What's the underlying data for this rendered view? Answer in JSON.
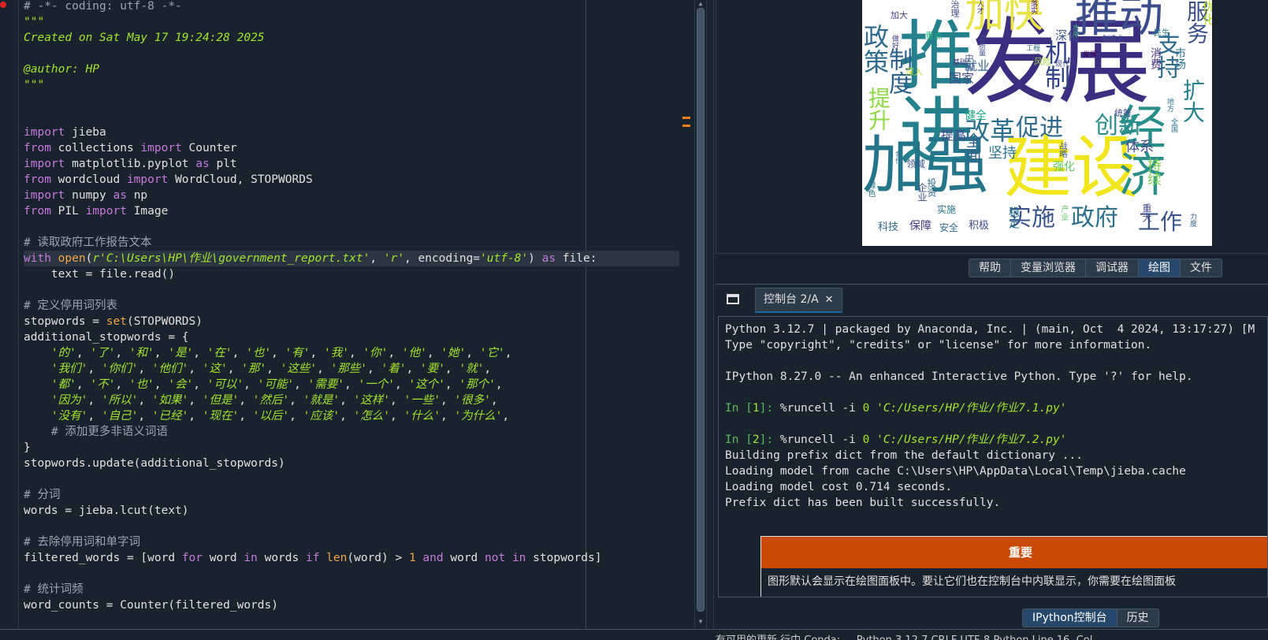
{
  "editor": {
    "lines": [
      [
        [
          "cm",
          "# -*- coding: utf-8 -*-"
        ]
      ],
      [
        [
          "doc",
          "\"\"\""
        ]
      ],
      [
        [
          "doc",
          "Created on Sat May 17 19:24:28 2025"
        ]
      ],
      [
        [
          "doc",
          ""
        ]
      ],
      [
        [
          "doc",
          "@author: HP"
        ]
      ],
      [
        [
          "doc",
          "\"\"\""
        ]
      ],
      [
        [
          "",
          ""
        ]
      ],
      [
        [
          "",
          ""
        ]
      ],
      [
        [
          "kw",
          "import"
        ],
        [
          "",
          " jieba"
        ]
      ],
      [
        [
          "kw",
          "from"
        ],
        [
          "",
          " collections "
        ],
        [
          "kw",
          "import"
        ],
        [
          "",
          " Counter"
        ]
      ],
      [
        [
          "kw",
          "import"
        ],
        [
          "",
          " matplotlib.pyplot "
        ],
        [
          "kw",
          "as"
        ],
        [
          "",
          " plt"
        ]
      ],
      [
        [
          "kw",
          "from"
        ],
        [
          "",
          " wordcloud "
        ],
        [
          "kw",
          "import"
        ],
        [
          "",
          " WordCloud, STOPWORDS"
        ]
      ],
      [
        [
          "kw",
          "import"
        ],
        [
          "",
          " numpy "
        ],
        [
          "kw",
          "as"
        ],
        [
          "",
          " np"
        ]
      ],
      [
        [
          "kw",
          "from"
        ],
        [
          "",
          " PIL "
        ],
        [
          "kw",
          "import"
        ],
        [
          "",
          " Image"
        ]
      ],
      [
        [
          "",
          ""
        ]
      ],
      [
        [
          "cm",
          "# 读取政府工作报告文本"
        ]
      ],
      [
        [
          "kw",
          "with"
        ],
        [
          "",
          " "
        ],
        [
          "bi",
          "open"
        ],
        [
          "",
          "("
        ],
        [
          "st",
          "r'C:\\Users\\HP\\作业\\government_report.txt'"
        ],
        [
          "",
          ", "
        ],
        [
          "st",
          "'r'"
        ],
        [
          "",
          ", encoding="
        ],
        [
          "st",
          "'utf-8'"
        ],
        [
          "",
          ") "
        ],
        [
          "kw",
          "as"
        ],
        [
          "",
          " file:"
        ]
      ],
      [
        [
          "",
          "    text = file.read()"
        ]
      ],
      [
        [
          "",
          ""
        ]
      ],
      [
        [
          "cm",
          "# 定义停用词列表"
        ]
      ],
      [
        [
          "",
          "stopwords = "
        ],
        [
          "bi",
          "set"
        ],
        [
          "",
          "(STOPWORDS)"
        ]
      ],
      [
        [
          "",
          "additional_stopwords = {"
        ]
      ],
      [
        [
          "",
          "    "
        ],
        [
          "st",
          "'的'"
        ],
        [
          "",
          ", "
        ],
        [
          "st",
          "'了'"
        ],
        [
          "",
          ", "
        ],
        [
          "st",
          "'和'"
        ],
        [
          "",
          ", "
        ],
        [
          "st",
          "'是'"
        ],
        [
          "",
          ", "
        ],
        [
          "st",
          "'在'"
        ],
        [
          "",
          ", "
        ],
        [
          "st",
          "'也'"
        ],
        [
          "",
          ", "
        ],
        [
          "st",
          "'有'"
        ],
        [
          "",
          ", "
        ],
        [
          "st",
          "'我'"
        ],
        [
          "",
          ", "
        ],
        [
          "st",
          "'你'"
        ],
        [
          "",
          ", "
        ],
        [
          "st",
          "'他'"
        ],
        [
          "",
          ", "
        ],
        [
          "st",
          "'她'"
        ],
        [
          "",
          ", "
        ],
        [
          "st",
          "'它'"
        ],
        [
          "",
          ","
        ]
      ],
      [
        [
          "",
          "    "
        ],
        [
          "st",
          "'我们'"
        ],
        [
          "",
          ", "
        ],
        [
          "st",
          "'你们'"
        ],
        [
          "",
          ", "
        ],
        [
          "st",
          "'他们'"
        ],
        [
          "",
          ", "
        ],
        [
          "st",
          "'这'"
        ],
        [
          "",
          ", "
        ],
        [
          "st",
          "'那'"
        ],
        [
          "",
          ", "
        ],
        [
          "st",
          "'这些'"
        ],
        [
          "",
          ", "
        ],
        [
          "st",
          "'那些'"
        ],
        [
          "",
          ", "
        ],
        [
          "st",
          "'着'"
        ],
        [
          "",
          ", "
        ],
        [
          "st",
          "'要'"
        ],
        [
          "",
          ", "
        ],
        [
          "st",
          "'就'"
        ],
        [
          "",
          ","
        ]
      ],
      [
        [
          "",
          "    "
        ],
        [
          "st",
          "'都'"
        ],
        [
          "",
          ", "
        ],
        [
          "st",
          "'不'"
        ],
        [
          "",
          ", "
        ],
        [
          "st",
          "'也'"
        ],
        [
          "",
          ", "
        ],
        [
          "st",
          "'会'"
        ],
        [
          "",
          ", "
        ],
        [
          "st",
          "'可以'"
        ],
        [
          "",
          ", "
        ],
        [
          "st",
          "'可能'"
        ],
        [
          "",
          ", "
        ],
        [
          "st",
          "'需要'"
        ],
        [
          "",
          ", "
        ],
        [
          "st",
          "'一个'"
        ],
        [
          "",
          ", "
        ],
        [
          "st",
          "'这个'"
        ],
        [
          "",
          ", "
        ],
        [
          "st",
          "'那个'"
        ],
        [
          "",
          ","
        ]
      ],
      [
        [
          "",
          "    "
        ],
        [
          "st",
          "'因为'"
        ],
        [
          "",
          ", "
        ],
        [
          "st",
          "'所以'"
        ],
        [
          "",
          ", "
        ],
        [
          "st",
          "'如果'"
        ],
        [
          "",
          ", "
        ],
        [
          "st",
          "'但是'"
        ],
        [
          "",
          ", "
        ],
        [
          "st",
          "'然后'"
        ],
        [
          "",
          ", "
        ],
        [
          "st",
          "'就是'"
        ],
        [
          "",
          ", "
        ],
        [
          "st",
          "'这样'"
        ],
        [
          "",
          ", "
        ],
        [
          "st",
          "'一些'"
        ],
        [
          "",
          ", "
        ],
        [
          "st",
          "'很多'"
        ],
        [
          "",
          ","
        ]
      ],
      [
        [
          "",
          "    "
        ],
        [
          "st",
          "'没有'"
        ],
        [
          "",
          ", "
        ],
        [
          "st",
          "'自己'"
        ],
        [
          "",
          ", "
        ],
        [
          "st",
          "'已经'"
        ],
        [
          "",
          ", "
        ],
        [
          "st",
          "'现在'"
        ],
        [
          "",
          ", "
        ],
        [
          "st",
          "'以后'"
        ],
        [
          "",
          ", "
        ],
        [
          "st",
          "'应该'"
        ],
        [
          "",
          ", "
        ],
        [
          "st",
          "'怎么'"
        ],
        [
          "",
          ", "
        ],
        [
          "st",
          "'什么'"
        ],
        [
          "",
          ", "
        ],
        [
          "st",
          "'为什么'"
        ],
        [
          "",
          ","
        ]
      ],
      [
        [
          "",
          "    "
        ],
        [
          "cm",
          "# 添加更多非语义词语"
        ]
      ],
      [
        [
          "",
          "}"
        ]
      ],
      [
        [
          "",
          "stopwords.update(additional_stopwords)"
        ]
      ],
      [
        [
          "",
          ""
        ]
      ],
      [
        [
          "cm",
          "# 分词"
        ]
      ],
      [
        [
          "",
          "words = jieba.lcut(text)"
        ]
      ],
      [
        [
          "",
          ""
        ]
      ],
      [
        [
          "cm",
          "# 去除停用词和单字词"
        ]
      ],
      [
        [
          "",
          "filtered_words = [word "
        ],
        [
          "kw",
          "for"
        ],
        [
          "",
          " word "
        ],
        [
          "kw",
          "in"
        ],
        [
          "",
          " words "
        ],
        [
          "kw",
          "if"
        ],
        [
          "",
          " "
        ],
        [
          "bi",
          "len"
        ],
        [
          "",
          "(word) > "
        ],
        [
          "nm",
          "1"
        ],
        [
          "",
          " "
        ],
        [
          "kw",
          "and"
        ],
        [
          "",
          " word "
        ],
        [
          "kw",
          "not"
        ],
        [
          "",
          " "
        ],
        [
          "kw",
          "in"
        ],
        [
          "",
          " stopwords]"
        ]
      ],
      [
        [
          "",
          ""
        ]
      ],
      [
        [
          "cm",
          "# 统计词频"
        ]
      ],
      [
        [
          "",
          "word_counts = Counter(filtered_words)"
        ]
      ]
    ],
    "highlighted_line": 16
  },
  "wordcloud": {
    "words": [
      {
        "t": "发展",
        "s": 118,
        "c": "#3b2d80"
      },
      {
        "t": "推进",
        "s": 96,
        "c": "#23808c"
      },
      {
        "t": "加强",
        "s": 80,
        "c": "#24748a"
      },
      {
        "t": "建设",
        "s": 86,
        "c": "#f1e51d"
      },
      {
        "t": "经济",
        "s": 60,
        "c": "#2a8f8a"
      },
      {
        "t": "推动",
        "s": 56,
        "c": "#3c4d8c"
      },
      {
        "t": "加快",
        "s": 50,
        "c": "#e9e34a"
      },
      {
        "t": "政策",
        "s": 32,
        "c": "#2f6c8e"
      },
      {
        "t": "制度",
        "s": 30,
        "c": "#2d5f8e"
      },
      {
        "t": "机制",
        "s": 32,
        "c": "#31418b"
      },
      {
        "t": "改革",
        "s": 32,
        "c": "#2b6f8e"
      },
      {
        "t": "促进",
        "s": 30,
        "c": "#2f6a8e"
      },
      {
        "t": "创新",
        "s": 30,
        "c": "#2a8e8b"
      },
      {
        "t": "提升",
        "s": 28,
        "c": "#8fd744"
      },
      {
        "t": "实施",
        "s": 30,
        "c": "#3a538b"
      },
      {
        "t": "政府",
        "s": 30,
        "c": "#2d708e"
      },
      {
        "t": "工作",
        "s": 28,
        "c": "#3b528b"
      },
      {
        "t": "支持",
        "s": 30,
        "c": "#2f6b8e"
      },
      {
        "t": "扩大",
        "s": 28,
        "c": "#26828e"
      },
      {
        "t": "服务",
        "s": 28,
        "c": "#3c4f8a"
      },
      {
        "t": "体系",
        "s": 18,
        "c": "#3d4e8a"
      },
      {
        "t": "坚持",
        "s": 18,
        "c": "#2c728e"
      },
      {
        "t": "持续",
        "s": 18,
        "c": "#7ad151"
      },
      {
        "t": "全面",
        "s": 20,
        "c": "#33638d"
      },
      {
        "t": "提高",
        "s": 16,
        "c": "#3f4889"
      },
      {
        "t": "健全",
        "s": 14,
        "c": "#22a884"
      },
      {
        "t": "实施",
        "s": 12,
        "c": "#2a788e"
      },
      {
        "t": "就业",
        "s": 16,
        "c": "#31688e"
      },
      {
        "t": "国家",
        "s": 16,
        "c": "#3e4a89"
      },
      {
        "t": "深化",
        "s": 15,
        "c": "#39558c"
      },
      {
        "t": "保障",
        "s": 14,
        "c": "#443983"
      },
      {
        "t": "安全",
        "s": 12,
        "c": "#31688e"
      },
      {
        "t": "积极",
        "s": 13,
        "c": "#3f4788"
      },
      {
        "t": "科技",
        "s": 13,
        "c": "#31688e"
      },
      {
        "t": "稳定",
        "s": 14,
        "c": "#2c718e"
      },
      {
        "t": "重大",
        "s": 12,
        "c": "#404688"
      },
      {
        "t": "力度",
        "s": 9,
        "c": "#31688e"
      },
      {
        "t": "领域",
        "s": 12,
        "c": "#3a548c"
      },
      {
        "t": "市场",
        "s": 14,
        "c": "#2c728e"
      },
      {
        "t": "消费",
        "s": 14,
        "c": "#472f7d"
      },
      {
        "t": "民生",
        "s": 10,
        "c": "#287c8e"
      },
      {
        "t": "制造业",
        "s": 9,
        "c": "#3e4c8a"
      },
      {
        "t": "风险",
        "s": 11,
        "c": "#a2da37"
      },
      {
        "t": "工程",
        "s": 9,
        "c": "#31688e"
      },
      {
        "t": "水平",
        "s": 9,
        "c": "#3dbc74"
      },
      {
        "t": "高质量",
        "s": 9,
        "c": "#3e4989"
      },
      {
        "t": "重点",
        "s": 11,
        "c": "#29af7f"
      },
      {
        "t": "中国",
        "s": 11,
        "c": "#3b528b"
      },
      {
        "t": "落实",
        "s": 9,
        "c": "#48186a"
      },
      {
        "t": "人才",
        "s": 9,
        "c": "#433e85"
      },
      {
        "t": "治理",
        "s": 11,
        "c": "#3f4889"
      },
      {
        "t": "优化",
        "s": 16,
        "c": "#b5de2b"
      },
      {
        "t": "强化",
        "s": 14,
        "c": "#5ec962"
      },
      {
        "t": "战略",
        "s": 10,
        "c": "#3b528b"
      },
      {
        "t": "产业",
        "s": 10,
        "c": "#5ec962"
      },
      {
        "t": "合作",
        "s": 9,
        "c": "#2c728e"
      },
      {
        "t": "绿色",
        "s": 10,
        "c": "#2a788e"
      },
      {
        "t": "投资",
        "s": 12,
        "c": "#2f6c8e"
      },
      {
        "t": "企业",
        "s": 12,
        "c": "#3d4e8a"
      },
      {
        "t": "基础",
        "s": 9,
        "c": "#453781"
      },
      {
        "t": "发挥",
        "s": 9,
        "c": "#440154"
      },
      {
        "t": "深入",
        "s": 11,
        "c": "#b8de29"
      },
      {
        "t": "统筹",
        "s": 11,
        "c": "#3f4788"
      },
      {
        "t": "全国",
        "s": 9,
        "c": "#2d708e"
      },
      {
        "t": "地方",
        "s": 9,
        "c": "#2d708e"
      },
      {
        "t": "现代化",
        "s": 9,
        "c": "#3f4788"
      },
      {
        "t": "加大",
        "s": 11,
        "c": "#404588"
      },
      {
        "t": "做好",
        "s": 9,
        "c": "#453882"
      }
    ]
  },
  "plot_tabs": [
    "帮助",
    "变量浏览器",
    "调试器",
    "绘图",
    "文件"
  ],
  "plot_tabs_active": 3,
  "console": {
    "tab_label": "控制台 2/A",
    "lines": [
      [
        [
          "",
          "Python 3.12.7 | packaged by Anaconda, Inc. | (main, Oct  4 2024, 13:17:27) [M"
        ]
      ],
      [
        [
          "",
          "Type \"copyright\", \"credits\" or \"license\" for more information."
        ]
      ],
      [
        [
          "",
          ""
        ]
      ],
      [
        [
          "",
          "IPython 8.27.0 -- An enhanced Interactive Python. Type '?' for help."
        ]
      ],
      [
        [
          "",
          ""
        ]
      ],
      [
        [
          "prompt",
          "In ["
        ],
        [
          "cnum",
          "1"
        ],
        [
          "prompt",
          "]: "
        ],
        [
          "magic",
          "%runcell -i "
        ],
        [
          "cnum",
          "0"
        ],
        [
          "",
          " "
        ],
        [
          "cstr",
          "'C:/Users/HP/作业/作业7.1.py'"
        ]
      ],
      [
        [
          "",
          ""
        ]
      ],
      [
        [
          "prompt",
          "In ["
        ],
        [
          "cnum",
          "2"
        ],
        [
          "prompt",
          "]: "
        ],
        [
          "magic",
          "%runcell -i "
        ],
        [
          "cnum",
          "0"
        ],
        [
          "",
          " "
        ],
        [
          "cstr",
          "'C:/Users/HP/作业/作业7.2.py'"
        ]
      ],
      [
        [
          "",
          "Building prefix dict from the default dictionary ..."
        ]
      ],
      [
        [
          "",
          "Loading model from cache C:\\Users\\HP\\AppData\\Local\\Temp\\jieba.cache"
        ]
      ],
      [
        [
          "",
          "Loading model cost 0.714 seconds."
        ]
      ],
      [
        [
          "",
          "Prefix dict has been built successfully."
        ]
      ]
    ],
    "important_title": "重要",
    "important_text": "图形默认会显示在绘图面板中。要让它们也在控制台中内联显示，你需要在绘图面板"
  },
  "console_tabs": [
    "IPython控制台",
    "历史"
  ],
  "console_tabs_active": 0,
  "statusbar": {
    "text": "有可用的更新    行中    Conda: ...  Python 3.12.7   CRLF  UTF-8  Python  Line 16, Col"
  }
}
